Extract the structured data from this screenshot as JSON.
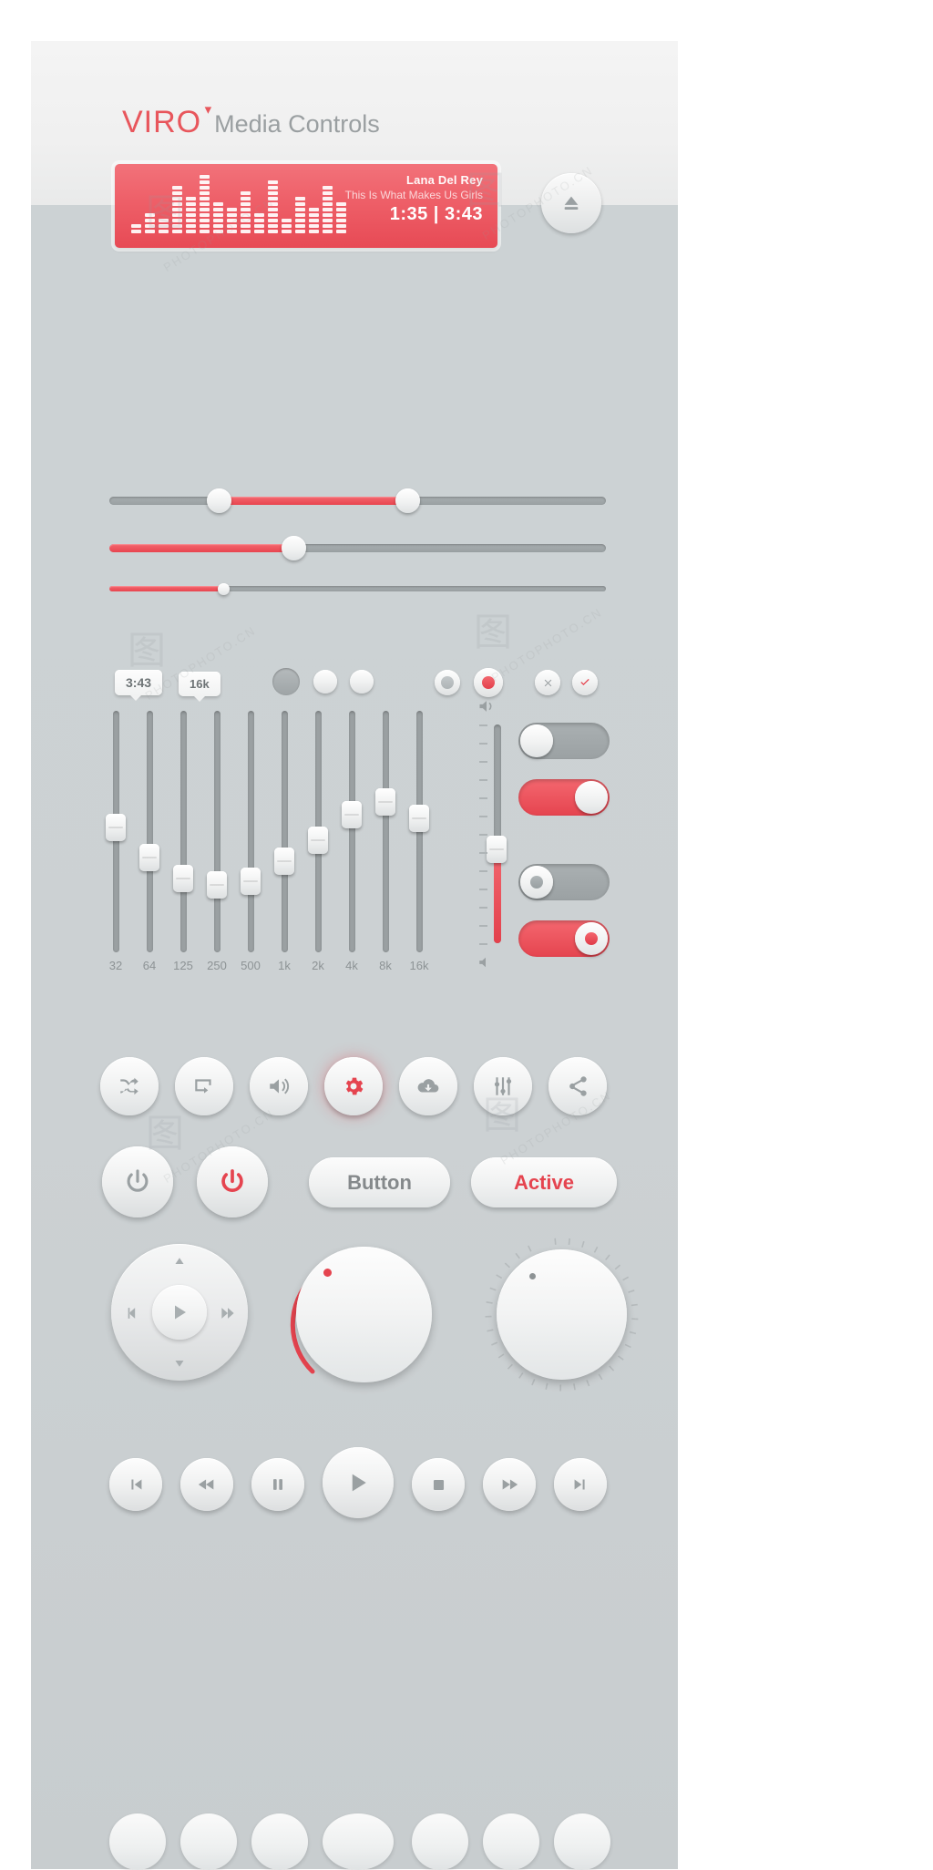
{
  "header": {
    "logo": "VIRO",
    "logo_mark": "▾",
    "title": "Media Controls",
    "brand_color": "#e8565c",
    "title_color": "#9a9fa1"
  },
  "display": {
    "artist": "Lana Del Rey",
    "track": "This Is What Makes Us Girls",
    "time_elapsed": "1:35",
    "time_separator": "|",
    "time_total": "3:43",
    "time_combined": "1:35 | 3:43",
    "bg_color": "#ee5f68",
    "eq_bar_levels": [
      2,
      4,
      3,
      9,
      7,
      11,
      6,
      5,
      8,
      4,
      10,
      3,
      7,
      5,
      9,
      6
    ]
  },
  "eject_button": {
    "label": "Eject",
    "icon": "eject-icon"
  },
  "sliders": [
    {
      "name": "range-slider",
      "fill_start_pct": 22,
      "fill_end_pct": 60,
      "style": "dual-handle"
    },
    {
      "name": "progress-slider",
      "fill_start_pct": 0,
      "fill_end_pct": 37,
      "style": "single-handle"
    },
    {
      "name": "thin-slider",
      "fill_start_pct": 0,
      "fill_end_pct": 23,
      "style": "small-handle"
    }
  ],
  "tooltips": [
    {
      "label": "3:43",
      "name": "tooltip-time"
    },
    {
      "label": "16k",
      "name": "tooltip-frequency"
    }
  ],
  "radio_group_left": [
    {
      "state": "selected-gray",
      "name": "radio-option-1"
    },
    {
      "state": "empty",
      "name": "radio-option-2"
    },
    {
      "state": "empty",
      "name": "radio-option-3"
    }
  ],
  "radio_group_right": [
    {
      "state": "gray",
      "name": "radio-off"
    },
    {
      "state": "red",
      "name": "radio-on"
    }
  ],
  "check_group": [
    {
      "icon": "close-icon",
      "state": "off",
      "name": "checkbox-reject"
    },
    {
      "icon": "check-icon",
      "state": "on",
      "name": "checkbox-accept"
    }
  ],
  "equalizer": {
    "bands": [
      "32",
      "64",
      "125",
      "250",
      "500",
      "1k",
      "2k",
      "4k",
      "8k",
      "16k"
    ],
    "values": [
      52,
      38,
      28,
      25,
      27,
      36,
      46,
      58,
      64,
      56
    ]
  },
  "volume_fader": {
    "icon_top": "volume-high-icon",
    "icon_bottom": "volume-mute-icon",
    "value": 42
  },
  "toggles": [
    {
      "name": "toggle-off-plain",
      "state": "off",
      "thumb": "plain",
      "color": "#9ba1a3"
    },
    {
      "name": "toggle-on-plain",
      "state": "on",
      "thumb": "plain",
      "color": "#e5444f"
    },
    {
      "name": "toggle-off-led",
      "state": "off",
      "thumb": "led-gray",
      "color": "#9ba1a3"
    },
    {
      "name": "toggle-on-led",
      "state": "on",
      "thumb": "led-red",
      "color": "#e5444f"
    }
  ],
  "icon_buttons": [
    {
      "name": "shuffle-icon",
      "label": "Shuffle",
      "active": false
    },
    {
      "name": "repeat-icon",
      "label": "Repeat",
      "active": false
    },
    {
      "name": "volume-icon",
      "label": "Volume",
      "active": false
    },
    {
      "name": "gear-icon",
      "label": "Settings",
      "active": true
    },
    {
      "name": "cloud-download-icon",
      "label": "Download",
      "active": false
    },
    {
      "name": "equalizer-icon",
      "label": "Equalizer",
      "active": false
    },
    {
      "name": "share-icon",
      "label": "Share",
      "active": false
    }
  ],
  "power_buttons": [
    {
      "name": "power-button-off",
      "label": "Power Off",
      "color": "#9aa0a2"
    },
    {
      "name": "power-button-on",
      "label": "Power On",
      "color": "#e5444f"
    }
  ],
  "pill_buttons": [
    {
      "name": "default-button",
      "label": "Button",
      "state": "default"
    },
    {
      "name": "active-button",
      "label": "Active",
      "state": "active"
    }
  ],
  "jog_dial": {
    "name": "jog-dial",
    "center_icon": "play-icon",
    "up": "menu-up-icon",
    "down": "menu-down-icon",
    "left": "previous-icon",
    "right": "next-icon"
  },
  "knobs": [
    {
      "name": "knob-with-arc",
      "value_pct": 18,
      "arc": true,
      "arc_color": "#e5444f"
    },
    {
      "name": "knob-notched",
      "value_pct": 12,
      "arc": false,
      "ticks": 32
    }
  ],
  "transport_buttons": [
    {
      "name": "skip-previous-icon",
      "label": "Previous Track"
    },
    {
      "name": "rewind-icon",
      "label": "Rewind"
    },
    {
      "name": "pause-icon",
      "label": "Pause"
    },
    {
      "name": "play-icon",
      "label": "Play"
    },
    {
      "name": "stop-icon",
      "label": "Stop"
    },
    {
      "name": "fast-forward-icon",
      "label": "Fast Forward"
    },
    {
      "name": "skip-next-icon",
      "label": "Next Track"
    }
  ],
  "watermark": {
    "text": "PHOTOPHOTO.CN",
    "mark": "图行天下"
  }
}
